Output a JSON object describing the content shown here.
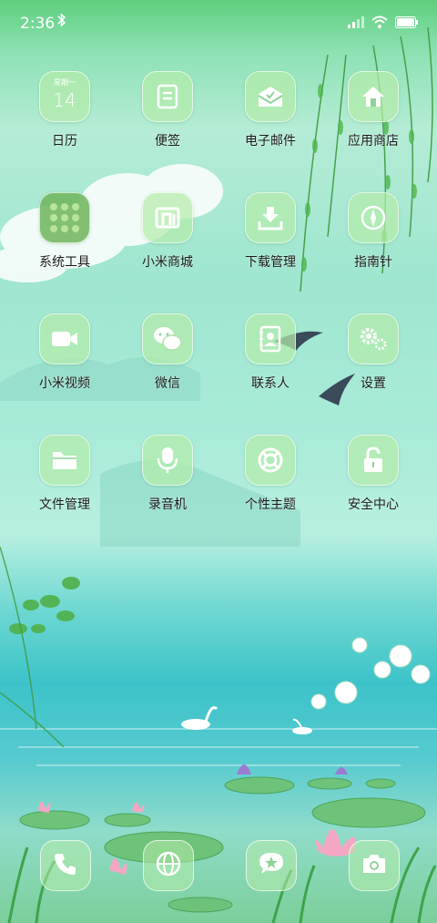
{
  "status_bar": {
    "time": "2:36"
  },
  "apps": [
    {
      "label": "日历",
      "icon": "calendar-icon",
      "cal_header": "星期一",
      "cal_day": "14"
    },
    {
      "label": "便签",
      "icon": "notes-icon"
    },
    {
      "label": "电子邮件",
      "icon": "email-icon"
    },
    {
      "label": "应用商店",
      "icon": "app-store-icon"
    },
    {
      "label": "系统工具",
      "icon": "system-tools-folder-icon"
    },
    {
      "label": "小米商城",
      "icon": "mi-store-icon"
    },
    {
      "label": "下载管理",
      "icon": "download-icon"
    },
    {
      "label": "指南针",
      "icon": "compass-icon"
    },
    {
      "label": "小米视频",
      "icon": "video-icon"
    },
    {
      "label": "微信",
      "icon": "wechat-icon"
    },
    {
      "label": "联系人",
      "icon": "contacts-icon"
    },
    {
      "label": "设置",
      "icon": "gear-icon"
    },
    {
      "label": "文件管理",
      "icon": "folder-icon"
    },
    {
      "label": "录音机",
      "icon": "microphone-icon"
    },
    {
      "label": "个性主题",
      "icon": "theme-icon"
    },
    {
      "label": "安全中心",
      "icon": "lock-icon"
    }
  ],
  "dock": [
    {
      "icon": "phone-icon"
    },
    {
      "icon": "browser-icon"
    },
    {
      "icon": "messages-icon"
    },
    {
      "icon": "camera-icon"
    }
  ]
}
